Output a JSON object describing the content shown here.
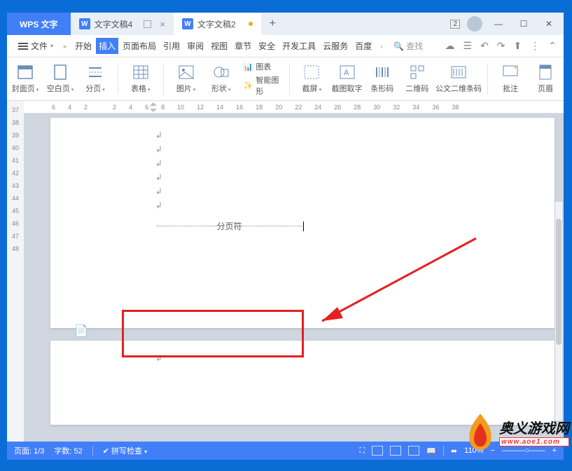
{
  "titlebar": {
    "app_tab": "WPS 文字",
    "tabs": [
      {
        "label": "文字文稿4",
        "active": false,
        "modified": false
      },
      {
        "label": "文字文稿2",
        "active": true,
        "modified": true
      }
    ],
    "account_badge": "2",
    "min": "—",
    "max": "☐",
    "close": "✕"
  },
  "menubar": {
    "file": "文件",
    "items": [
      "开始",
      "插入",
      "页面布局",
      "引用",
      "审阅",
      "视图",
      "章节",
      "安全",
      "开发工具",
      "云服务",
      "百度"
    ],
    "active_index": 1,
    "search_label": "查找"
  },
  "ribbon": {
    "items": [
      {
        "label": "封面页",
        "drop": true
      },
      {
        "label": "空白页",
        "drop": true
      },
      {
        "label": "分页",
        "drop": true
      },
      {
        "label": "表格",
        "drop": true
      },
      {
        "label": "图片",
        "drop": true
      },
      {
        "label": "形状",
        "drop": true
      }
    ],
    "two_line": {
      "top": "图表",
      "bottom": "智能图形"
    },
    "items2": [
      {
        "label": "截屏",
        "drop": true
      },
      {
        "label": "截图取字"
      },
      {
        "label": "条形码"
      },
      {
        "label": "二维码"
      },
      {
        "label": "公文二维条码"
      },
      {
        "label": "批注"
      },
      {
        "label": "页眉"
      }
    ]
  },
  "ruler": {
    "h": [
      "6",
      "4",
      "2",
      "",
      "2",
      "4",
      "6",
      "8",
      "10",
      "12",
      "14",
      "16",
      "18",
      "20",
      "22",
      "24",
      "26",
      "28",
      "30",
      "32",
      "34",
      "36",
      "38"
    ],
    "v": [
      "37",
      "38",
      "39",
      "40",
      "41",
      "42",
      "43",
      "44",
      "45",
      "46",
      "47",
      "48"
    ]
  },
  "document": {
    "page_break_label": "分页符"
  },
  "statusbar": {
    "page": "页面: 1/3",
    "words": "字数: 52",
    "spell": "拼写检查",
    "zoom": "110%",
    "minus": "−",
    "plus": "+"
  },
  "watermark": {
    "cn": "奥义游戏网",
    "en": "www.aoe1.com"
  }
}
